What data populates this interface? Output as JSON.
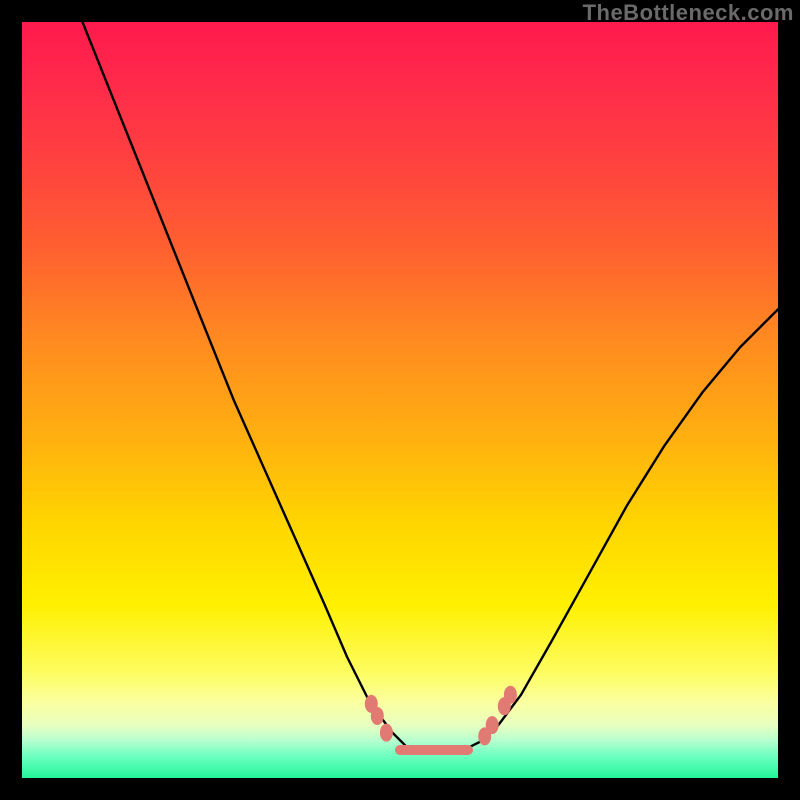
{
  "watermark": "TheBottleneck.com",
  "colors": {
    "frame": "#000000",
    "curve": "#000000",
    "marker": "#e07a72",
    "gradient_top": "#ff1a4d",
    "gradient_bottom": "#22f59a"
  },
  "chart_data": {
    "type": "line",
    "title": "",
    "xlabel": "",
    "ylabel": "",
    "xlim": [
      0,
      100
    ],
    "ylim": [
      0,
      100
    ],
    "series": [
      {
        "name": "bottleneck-curve",
        "x": [
          8,
          12,
          16,
          20,
          24,
          28,
          32,
          36,
          40,
          43,
          46,
          49,
          51,
          53,
          56,
          59,
          61,
          63,
          66,
          70,
          75,
          80,
          85,
          90,
          95,
          100
        ],
        "y": [
          100,
          90,
          80,
          70,
          60,
          50,
          41,
          32,
          23,
          16,
          10,
          6,
          4,
          4,
          4,
          4,
          5,
          7,
          11,
          18,
          27,
          36,
          44,
          51,
          57,
          62
        ]
      }
    ],
    "markers": [
      {
        "x": 46.2,
        "y": 9.8
      },
      {
        "x": 47.0,
        "y": 8.2
      },
      {
        "x": 48.2,
        "y": 6.0
      },
      {
        "x": 61.2,
        "y": 5.5
      },
      {
        "x": 62.2,
        "y": 7.0
      },
      {
        "x": 63.8,
        "y": 9.5
      },
      {
        "x": 64.6,
        "y": 11.0
      }
    ],
    "flat_segment": {
      "x0": 50,
      "x1": 59,
      "y": 3.7
    }
  }
}
